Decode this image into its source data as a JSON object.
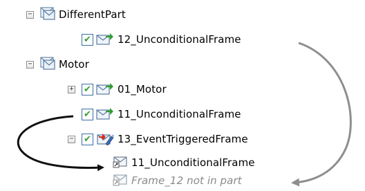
{
  "tree": {
    "nodes": [
      {
        "label": "DifferentPart",
        "expander": "minus",
        "checkbox": false,
        "icon": "pdu-group-icon"
      },
      {
        "label": "12_UnconditionalFrame",
        "expander": null,
        "checkbox": true,
        "icon": "frame-send-icon"
      },
      {
        "label": "Motor",
        "expander": "minus",
        "checkbox": false,
        "icon": "pdu-group-icon"
      },
      {
        "label": "01_Motor",
        "expander": "plus",
        "checkbox": true,
        "icon": "frame-send-icon"
      },
      {
        "label": "11_UnconditionalFrame",
        "expander": null,
        "checkbox": true,
        "icon": "frame-send-icon"
      },
      {
        "label": "13_EventTriggeredFrame",
        "expander": "minus",
        "checkbox": true,
        "icon": "event-frame-icon"
      },
      {
        "label": "11_UnconditionalFrame",
        "expander": null,
        "checkbox": false,
        "icon": "frame-link-icon"
      },
      {
        "label": "Frame_12 not in part",
        "expander": null,
        "checkbox": false,
        "icon": "frame-link-ghost-icon",
        "ghost": true
      }
    ]
  },
  "colors": {
    "accent_green": "#2e9e2e",
    "accent_red": "#d42a1a",
    "checkbox_border": "#3a6ea5",
    "arrow_black": "#111111",
    "arrow_gray": "#8e8e8e",
    "ghost_text": "#8a8a8a"
  },
  "expander_glyphs": {
    "minus": "−",
    "plus": "+"
  },
  "checkbox_glyph": "✔"
}
